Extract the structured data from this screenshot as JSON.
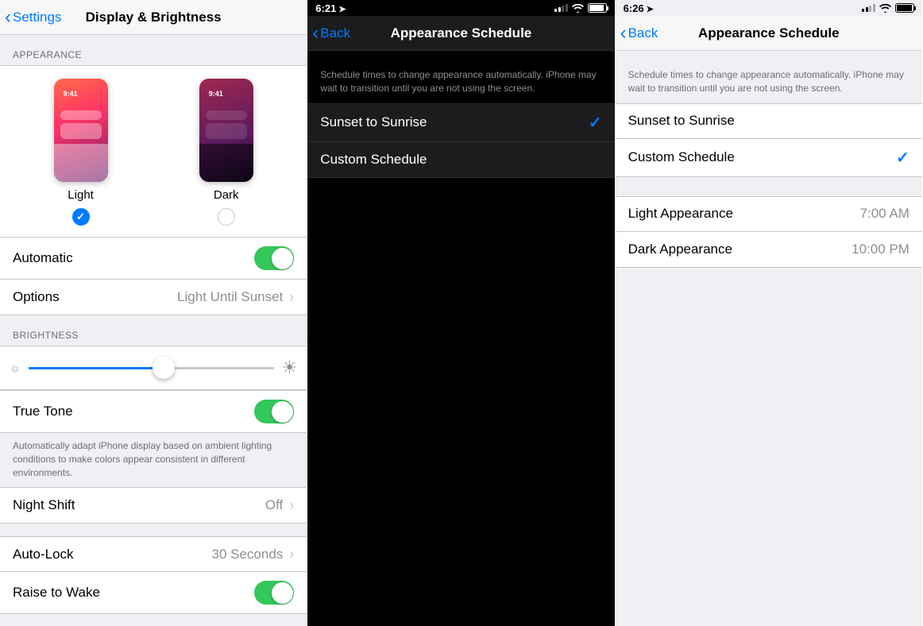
{
  "pane1": {
    "nav": {
      "back": "Settings",
      "title": "Display & Brightness"
    },
    "appearance": {
      "header": "APPEARANCE",
      "previewTime": "9:41",
      "light": "Light",
      "dark": "Dark",
      "selected": "light",
      "automatic": {
        "label": "Automatic",
        "on": true
      },
      "options": {
        "label": "Options",
        "value": "Light Until Sunset"
      }
    },
    "brightness": {
      "header": "BRIGHTNESS",
      "percent": 55,
      "trueTone": {
        "label": "True Tone",
        "on": true
      },
      "note": "Automatically adapt iPhone display based on ambient lighting conditions to make colors appear consistent in different environments."
    },
    "nightShift": {
      "label": "Night Shift",
      "value": "Off"
    },
    "autoLock": {
      "label": "Auto-Lock",
      "value": "30 Seconds"
    },
    "raiseToWake": {
      "label": "Raise to Wake",
      "on": true
    }
  },
  "pane2": {
    "status": {
      "time": "6:21"
    },
    "nav": {
      "back": "Back",
      "title": "Appearance Schedule"
    },
    "note": "Schedule times to change appearance automatically. iPhone may wait to transition until you are not using the screen.",
    "options": {
      "sunset": "Sunset to Sunrise",
      "custom": "Custom Schedule",
      "selected": "sunset"
    }
  },
  "pane3": {
    "status": {
      "time": "6:26"
    },
    "nav": {
      "back": "Back",
      "title": "Appearance Schedule"
    },
    "note": "Schedule times to change appearance automatically. iPhone may wait to transition until you are not using the screen.",
    "options": {
      "sunset": "Sunset to Sunrise",
      "custom": "Custom Schedule",
      "selected": "custom"
    },
    "times": {
      "light": {
        "label": "Light Appearance",
        "value": "7:00 AM"
      },
      "dark": {
        "label": "Dark Appearance",
        "value": "10:00 PM"
      }
    }
  }
}
